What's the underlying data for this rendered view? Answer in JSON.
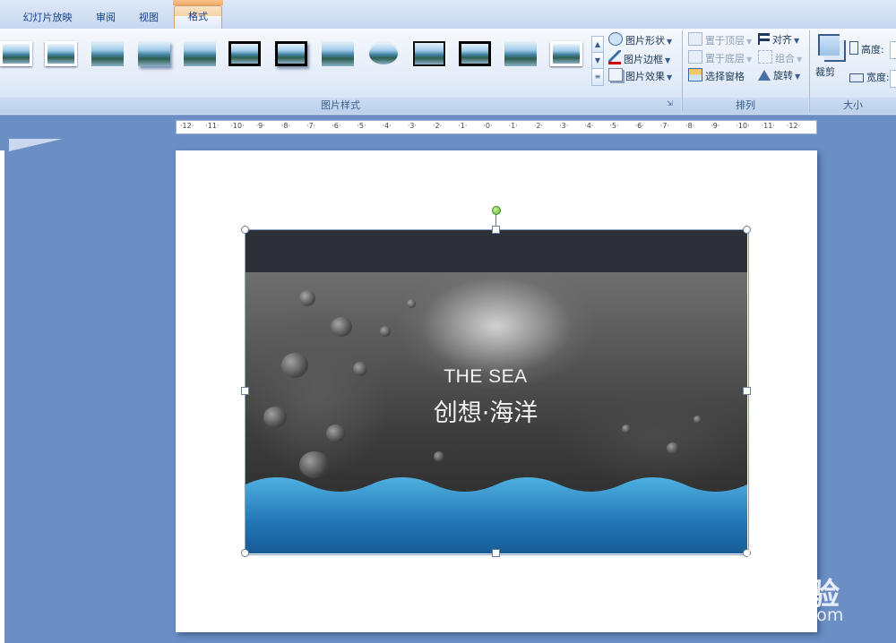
{
  "tabs": [
    {
      "label": "幻灯片放映"
    },
    {
      "label": "审阅"
    },
    {
      "label": "视图"
    },
    {
      "label": "格式",
      "active": true
    }
  ],
  "ribbon": {
    "picture_styles": {
      "group_label": "图片样式",
      "gallery": [
        "simple-frame-white",
        "simple-frame-white",
        "soft-edge",
        "reflected",
        "soft-edge-rectangle",
        "thick-black-frame",
        "black-frame-shadow",
        "thin-frame",
        "oval",
        "double-frame-black",
        "thick-matte-black",
        "rounded-soft",
        "soft-frame-white"
      ],
      "shape_label": "图片形状",
      "border_label": "图片边框",
      "effects_label": "图片效果"
    },
    "arrange": {
      "group_label": "排列",
      "bring_front_label": "置于顶层",
      "send_back_label": "置于底层",
      "selection_pane_label": "选择窗格",
      "align_label": "对齐",
      "group_label_btn": "组合",
      "rotate_label": "旋转"
    },
    "size": {
      "group_label": "大小",
      "crop_label": "裁剪",
      "height_label": "高度:",
      "width_label": "宽度:"
    }
  },
  "ruler": {
    "ticks": [
      "12",
      "11",
      "10",
      "9",
      "8",
      "7",
      "6",
      "5",
      "4",
      "3",
      "2",
      "1",
      "0",
      "1",
      "2",
      "3",
      "4",
      "5",
      "6",
      "7",
      "8",
      "9",
      "10",
      "11",
      "12"
    ]
  },
  "slide": {
    "picture": {
      "title_en": "THE SEA",
      "title_zh": "创想·海洋"
    }
  },
  "watermark": {
    "main": "Baidu经验",
    "sub": "jingyan.baidu.com"
  },
  "colors": {
    "accent_tab": "#f7d4a6",
    "workspace": "#6b8fc4",
    "ribbon": "#dfe9f7"
  }
}
